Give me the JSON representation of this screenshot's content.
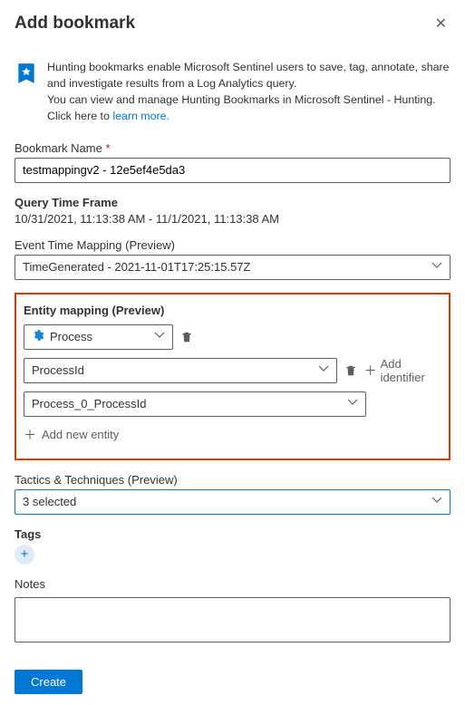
{
  "header": {
    "title": "Add bookmark"
  },
  "info": {
    "line1": "Hunting bookmarks enable Microsoft Sentinel users to save, tag, annotate, share and investigate results from a Log Analytics query.",
    "line2a": "You can view and manage Hunting Bookmarks in Microsoft Sentinel - Hunting. Click here to ",
    "learn": "learn more."
  },
  "bookmarkName": {
    "label": "Bookmark Name",
    "value": "testmappingv2 - 12e5ef4e5da3"
  },
  "queryTime": {
    "label": "Query Time Frame",
    "value": "10/31/2021, 11:13:38 AM - 11/1/2021, 11:13:38 AM"
  },
  "eventTime": {
    "label": "Event Time Mapping (Preview)",
    "value": "TimeGenerated - 2021-11-01T17:25:15.57Z"
  },
  "entity": {
    "label": "Entity mapping (Preview)",
    "typeValue": "Process",
    "idField": "ProcessId",
    "idValue": "Process_0_ProcessId",
    "addIdentifier": "Add identifier",
    "addEntity": "Add new entity"
  },
  "tactics": {
    "label": "Tactics & Techniques (Preview)",
    "value": "3 selected"
  },
  "tags": {
    "label": "Tags"
  },
  "notes": {
    "label": "Notes"
  },
  "buttons": {
    "create": "Create"
  }
}
